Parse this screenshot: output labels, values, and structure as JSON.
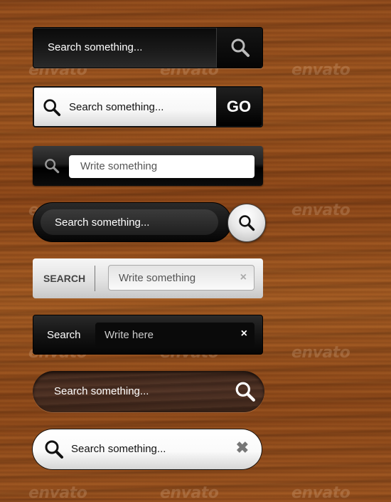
{
  "background": {
    "style": "wood",
    "base_color": "#8e4a1c"
  },
  "watermark": "envato",
  "search_bars": [
    {
      "variant": "dark-square-with-icon-button",
      "placeholder": "Search something...",
      "button_icon": "search-icon"
    },
    {
      "variant": "light-square-with-go-button",
      "placeholder": "Search something...",
      "leading_icon": "search-icon",
      "button_label": "GO"
    },
    {
      "variant": "dark-glossy-with-white-field",
      "placeholder": "Write something",
      "leading_icon": "search-icon"
    },
    {
      "variant": "dark-pill-with-round-button",
      "placeholder": "Search something...",
      "button_icon": "search-icon"
    },
    {
      "variant": "silver-labeled-with-clear",
      "label": "SEARCH",
      "placeholder": "Write something",
      "clear_icon": "×"
    },
    {
      "variant": "dark-labeled-with-clear",
      "label": "Search",
      "placeholder": "Write here",
      "clear_icon": "×"
    },
    {
      "variant": "wood-pill-with-icon",
      "placeholder": "Search something...",
      "trailing_icon": "search-icon"
    },
    {
      "variant": "white-pill-with-clear",
      "placeholder": "Search something...",
      "leading_icon": "search-icon",
      "clear_icon": "✖"
    }
  ]
}
